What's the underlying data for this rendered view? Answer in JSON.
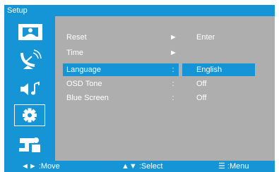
{
  "title": "Setup",
  "sidebar": {
    "items": [
      {
        "name": "picture",
        "icon": "picture-icon"
      },
      {
        "name": "channel",
        "icon": "satellite-dish-icon"
      },
      {
        "name": "sound",
        "icon": "sound-icon"
      },
      {
        "name": "setup",
        "icon": "gear-icon",
        "active": true
      },
      {
        "name": "lock",
        "icon": "parental-lock-icon"
      }
    ]
  },
  "menu": {
    "rows": [
      {
        "label": "Reset",
        "sep": "►",
        "value": "Enter"
      },
      {
        "label": "Time",
        "sep": "►",
        "value": ""
      },
      {
        "label": "Language",
        "sep": ":",
        "value": "English",
        "selected": true
      },
      {
        "label": "OSD Tone",
        "sep": ":",
        "value": "Off"
      },
      {
        "label": "Blue Screen",
        "sep": ":",
        "value": "Off"
      }
    ]
  },
  "bottom": {
    "move": "◄► :Move",
    "select": "▲▼ :Select",
    "menu": "☰ :Menu"
  },
  "colors": {
    "accent": "#1594d6",
    "panel": "#aeaeae"
  }
}
